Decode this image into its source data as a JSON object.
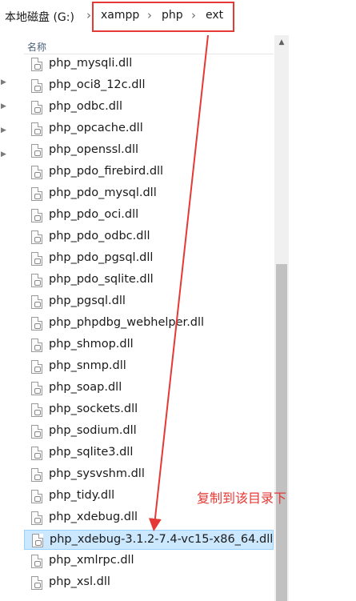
{
  "breadcrumb": {
    "drive": "本地磁盘 (G:)",
    "items": [
      "xampp",
      "php",
      "ext"
    ],
    "separator": "›"
  },
  "list_header": {
    "name_column": "名称"
  },
  "files": [
    "php_mysqli.dll",
    "php_oci8_12c.dll",
    "php_odbc.dll",
    "php_opcache.dll",
    "php_openssl.dll",
    "php_pdo_firebird.dll",
    "php_pdo_mysql.dll",
    "php_pdo_oci.dll",
    "php_pdo_odbc.dll",
    "php_pdo_pgsql.dll",
    "php_pdo_sqlite.dll",
    "php_pgsql.dll",
    "php_phpdbg_webhelper.dll",
    "php_shmop.dll",
    "php_snmp.dll",
    "php_soap.dll",
    "php_sockets.dll",
    "php_sodium.dll",
    "php_sqlite3.dll",
    "php_sysvshm.dll",
    "php_tidy.dll",
    "php_xdebug.dll",
    "php_xdebug-3.1.2-7.4-vc15-x86_64.dll",
    "php_xmlrpc.dll",
    "php_xsl.dll"
  ],
  "selected_file": "php_xdebug-3.1.2-7.4-vc15-x86_64.dll",
  "annotation": {
    "text": "复制到该目录下",
    "color": "#e53935"
  },
  "icons": {
    "file": "dll-file-icon",
    "scroll_up": "scroll-up-icon",
    "nav_expand": "chevron-right-icon"
  }
}
